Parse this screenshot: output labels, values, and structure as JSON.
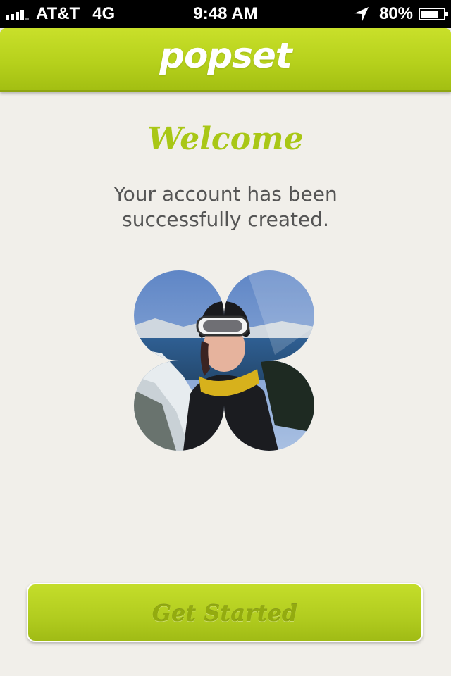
{
  "status_bar": {
    "carrier": "AT&T",
    "network": "4G",
    "time": "9:48 AM",
    "battery_percent_text": "80%",
    "battery_level": 0.8,
    "icons": [
      "signal-icon",
      "location-arrow-icon",
      "battery-icon"
    ]
  },
  "header": {
    "logo_text": "popset",
    "color": "#b6d11c"
  },
  "main": {
    "welcome_title": "Welcome",
    "message": "Your account has been successfully created."
  },
  "actions": {
    "get_started_label": "Get Started"
  },
  "colors": {
    "brand_green": "#b6d11c",
    "title_green": "#a9c716",
    "background": "#f1efea"
  }
}
